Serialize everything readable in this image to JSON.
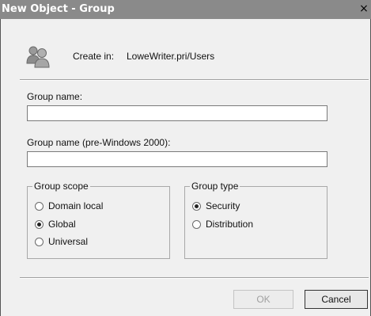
{
  "window": {
    "title": "New Object - Group",
    "close_glyph": "×"
  },
  "header": {
    "icon": "group-icon",
    "create_in_label": "Create in:",
    "create_in_value": "LoweWriter.pri/Users"
  },
  "fields": {
    "group_name_label": "Group name:",
    "group_name_value": "",
    "pre2000_label": "Group name (pre-Windows 2000):",
    "pre2000_value": ""
  },
  "group_scope": {
    "title": "Group scope",
    "options": [
      {
        "label": "Domain local",
        "selected": false
      },
      {
        "label": "Global",
        "selected": true
      },
      {
        "label": "Universal",
        "selected": false
      }
    ]
  },
  "group_type": {
    "title": "Group type",
    "options": [
      {
        "label": "Security",
        "selected": true
      },
      {
        "label": "Distribution",
        "selected": false
      }
    ]
  },
  "buttons": {
    "ok_label": "OK",
    "ok_enabled": false,
    "cancel_label": "Cancel"
  }
}
